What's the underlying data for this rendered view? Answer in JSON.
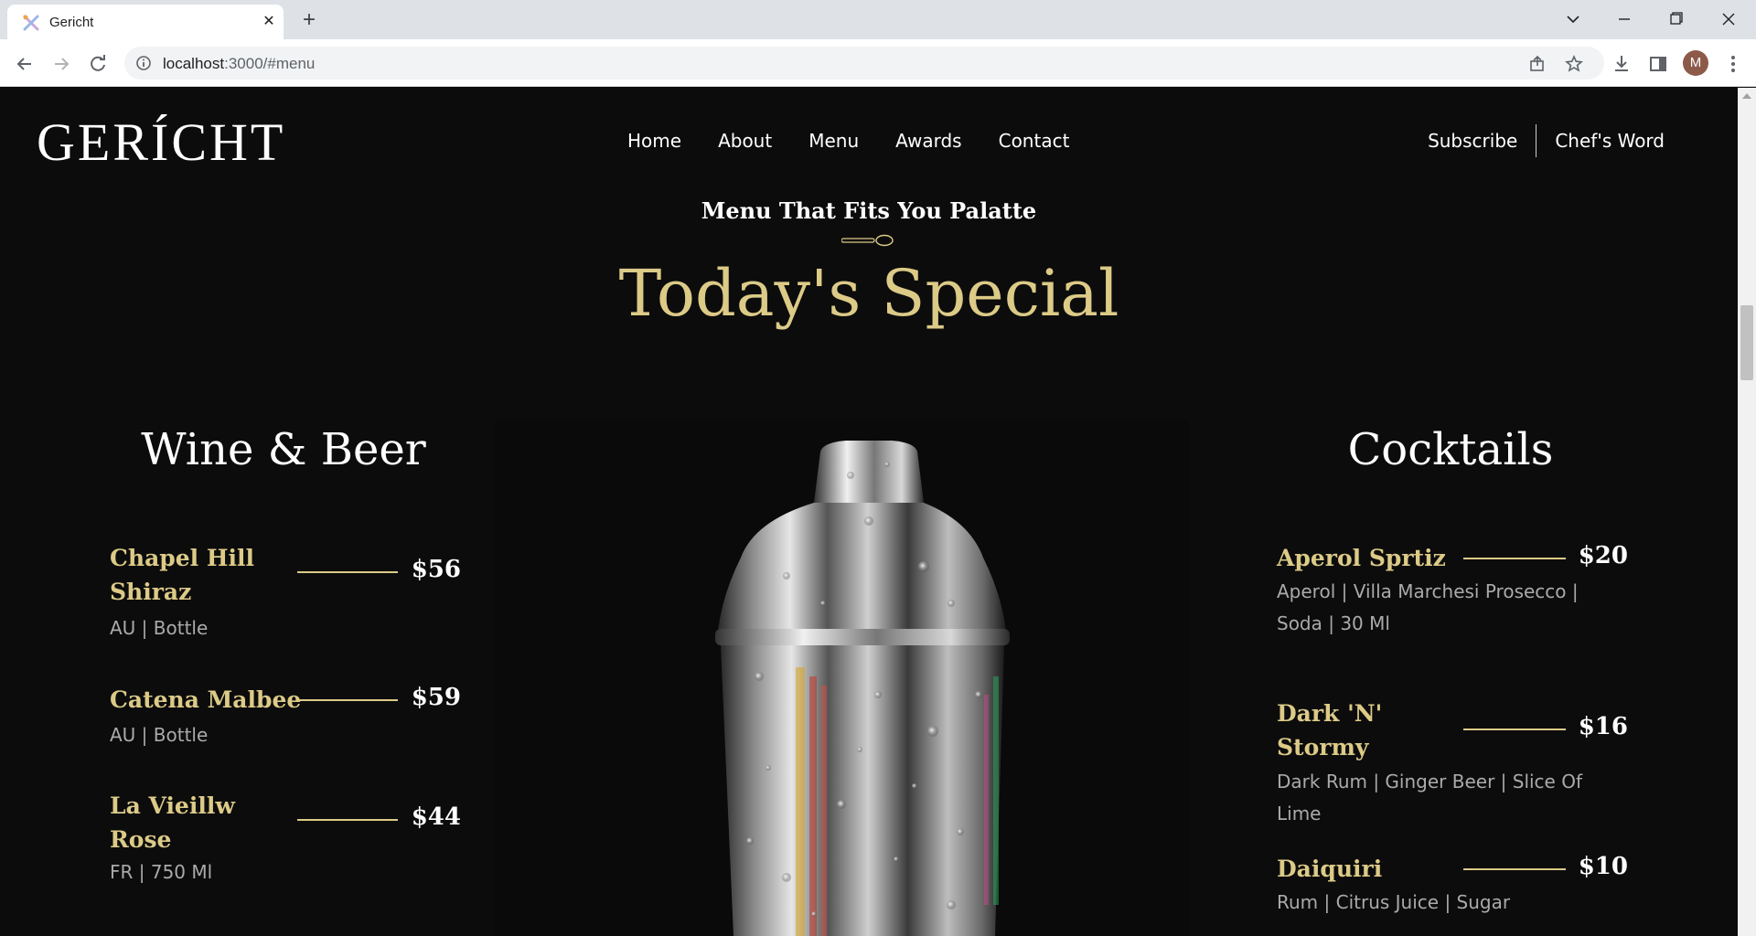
{
  "browser": {
    "tab_title": "Gericht",
    "tab_close": "✕",
    "new_tab": "+",
    "url_host": "localhost",
    "url_rest": ":3000/#menu",
    "profile_initial": "M"
  },
  "site": {
    "logo": "GERÍCHT",
    "nav": [
      "Home",
      "About",
      "Menu",
      "Awards",
      "Contact"
    ],
    "nav_right": [
      "Subscribe",
      "Chef's Word"
    ]
  },
  "menu_section": {
    "subtitle": "Menu That Fits You Palatte",
    "title": "Today's Special",
    "wine_title": "Wine & Beer",
    "cocktail_title": "Cocktails",
    "wine_items": [
      {
        "name_line1": "Chapel Hill",
        "name_line2": "Shiraz",
        "price": "$56",
        "tags": "AU | Bottle"
      },
      {
        "name_line1": "Catena Malbee",
        "name_line2": "",
        "price": "$59",
        "tags": "AU | Bottle"
      },
      {
        "name_line1": "La Vieillw",
        "name_line2": "Rose",
        "price": "$44",
        "tags": "FR | 750 Ml"
      }
    ],
    "cocktail_items": [
      {
        "name_line1": "Aperol Sprtiz",
        "name_line2": "",
        "price": "$20",
        "tags_line1": "Aperol | Villa Marchesi Prosecco |",
        "tags_line2": "Soda | 30 Ml"
      },
      {
        "name_line1": "Dark 'N'",
        "name_line2": "Stormy",
        "price": "$16",
        "tags_line1": "Dark Rum | Ginger Beer | Slice Of",
        "tags_line2": "Lime"
      },
      {
        "name_line1": "Daiquiri",
        "name_line2": "",
        "price": "$10",
        "tags_line1": "Rum | Citrus Juice | Sugar",
        "tags_line2": ""
      }
    ]
  },
  "colors": {
    "gold": "#dcca87",
    "background": "#0c0c0c",
    "text": "#ffffff",
    "muted": "#aaaaaa"
  }
}
